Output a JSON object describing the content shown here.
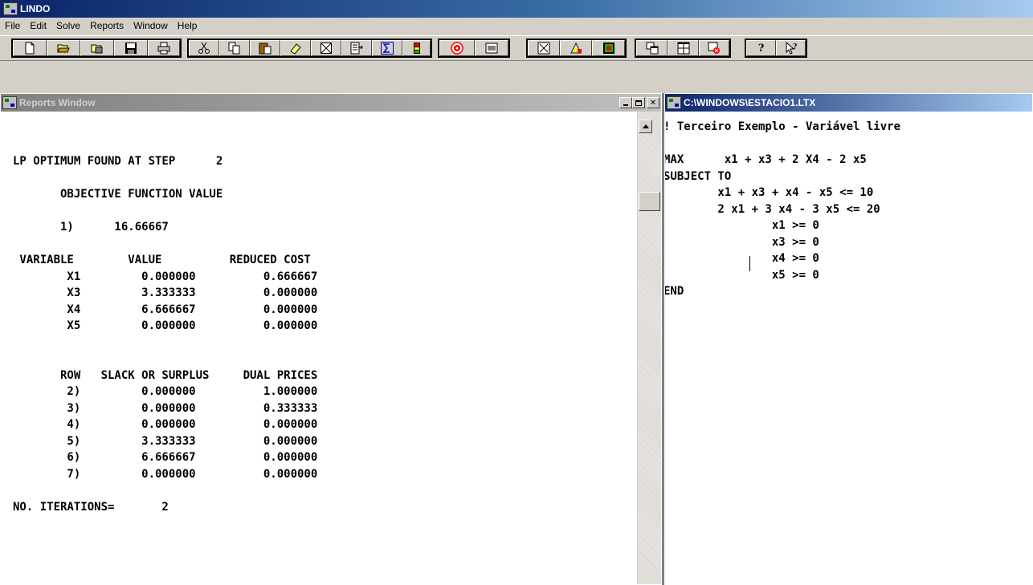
{
  "app": {
    "title": "LINDO",
    "menu": [
      "File",
      "Edit",
      "Solve",
      "Reports",
      "Window",
      "Help"
    ]
  },
  "toolbar": {
    "groups": [
      [
        "new-icon",
        "open-icon",
        "view-icon",
        "save-icon",
        "print-icon"
      ],
      [
        "cut-icon",
        "copy-icon",
        "paste-icon",
        "clear-icon",
        "select-all-icon",
        "go-to-line-icon",
        "sum-icon",
        "compile-icon"
      ],
      [
        "solve-icon",
        "options-icon"
      ],
      [
        "picture-icon",
        "tableau-icon",
        "peruse-icon"
      ],
      [
        "cascade-icon",
        "tile-icon",
        "close-all-icon"
      ],
      [
        "help-icon",
        "context-help-icon"
      ]
    ]
  },
  "reports_window": {
    "title": "Reports Window",
    "lines": [
      "LP OPTIMUM FOUND AT STEP      2",
      "",
      "       OBJECTIVE FUNCTION VALUE",
      "",
      "       1)      16.66667",
      "",
      " VARIABLE        VALUE          REDUCED COST",
      "        X1         0.000000          0.666667",
      "        X3         3.333333          0.000000",
      "        X4         6.666667          0.000000",
      "        X5         0.000000          0.000000",
      "",
      "",
      "       ROW   SLACK OR SURPLUS     DUAL PRICES",
      "        2)         0.000000          1.000000",
      "        3)         0.000000          0.333333",
      "        4)         0.000000          0.000000",
      "        5)         3.333333          0.000000",
      "        6)         6.666667          0.000000",
      "        7)         0.000000          0.000000",
      "",
      "NO. ITERATIONS=       2"
    ]
  },
  "model_window": {
    "title": "C:\\WINDOWS\\ESTACIO1.LTX",
    "lines": [
      "! Terceiro Exemplo - Variável livre",
      "",
      "MAX      x1 + x3 + 2 X4 - 2 x5",
      "SUBJECT TO",
      "        x1 + x3 + x4 - x5 <= 10",
      "        2 x1 + 3 x4 - 3 x5 <= 20",
      "                x1 >= 0",
      "                x3 >= 0",
      "                x4 >= 0",
      "                x5 >= 0",
      "END"
    ]
  }
}
